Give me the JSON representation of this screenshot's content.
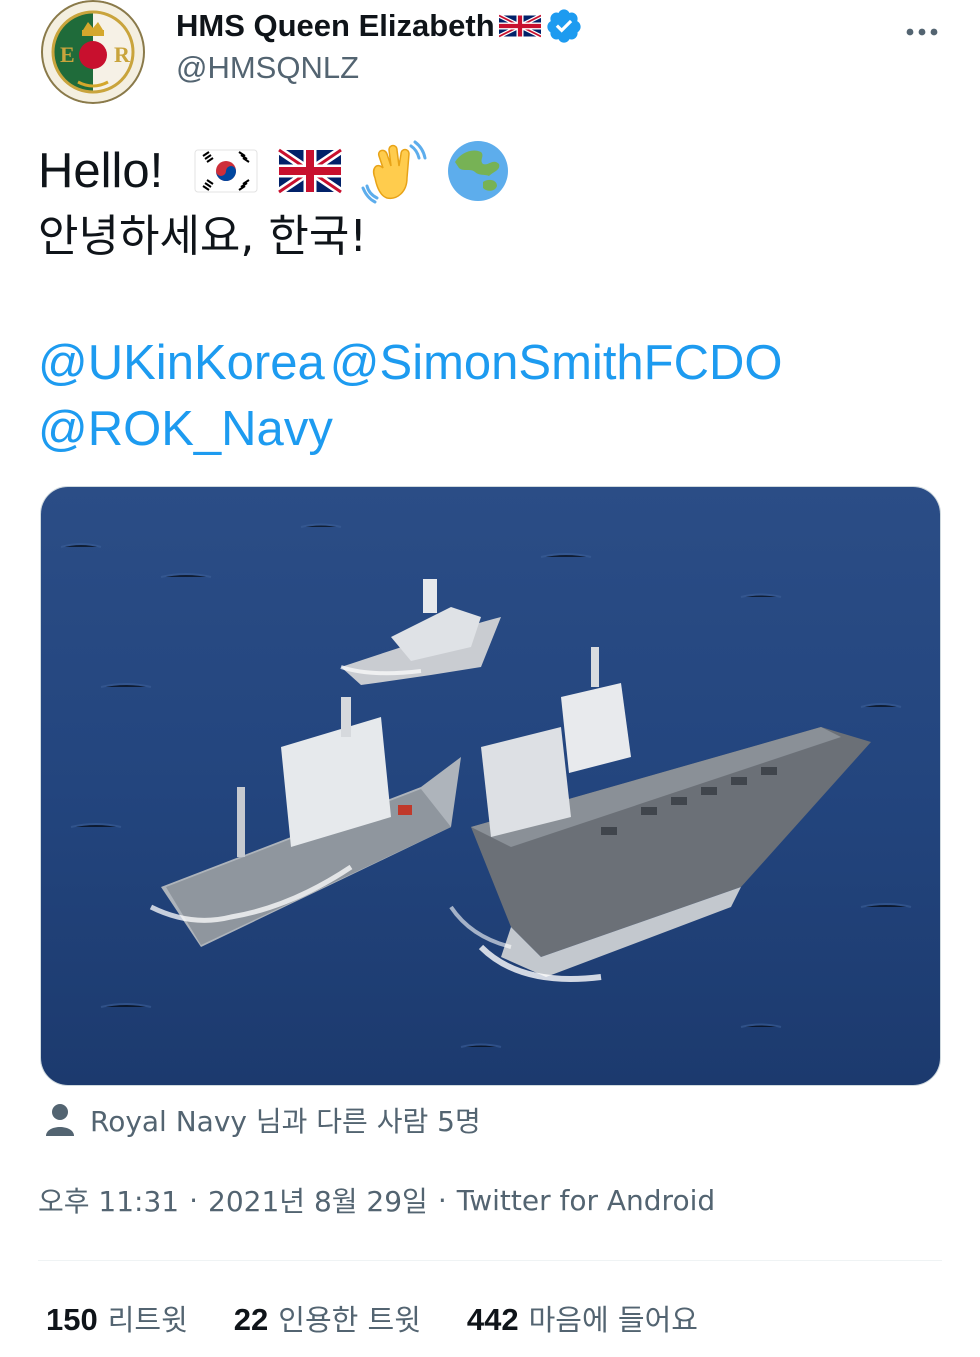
{
  "author": {
    "display_name": "HMS Queen Elizabeth",
    "handle": "@HMSQNLZ",
    "name_flag_icon": "uk-flag-icon",
    "verified_icon": "verified-badge-icon"
  },
  "header": {
    "more_icon": "more-options-icon"
  },
  "tweet": {
    "line1_text": "Hello!",
    "line1_emojis": [
      "south-korea-flag-icon",
      "uk-flag-icon",
      "waving-hand-icon",
      "globe-asia-australia-icon"
    ],
    "line2_text": "안녕하세요, 한국!",
    "mentions": [
      "@UKinKorea",
      "@SimonSmithFCDO",
      "@ROK_Navy"
    ]
  },
  "media": {
    "icon": "ships-at-sea-photo"
  },
  "tagged": {
    "icon": "person-icon",
    "text": "Royal Navy 님과 다른 사람 5명"
  },
  "meta": {
    "time": "오후 11:31",
    "separator": "·",
    "date": "2021년 8월 29일",
    "source": "Twitter for Android"
  },
  "stats": {
    "retweets_count": "150",
    "retweets_label": "리트윗",
    "quotes_count": "22",
    "quotes_label": "인용한 트윗",
    "likes_count": "442",
    "likes_label": "마음에 들어요"
  },
  "colors": {
    "link": "#1d9bf0",
    "secondary_text": "#536471",
    "primary_text": "#0f1419",
    "verified": "#1d9bf0"
  }
}
